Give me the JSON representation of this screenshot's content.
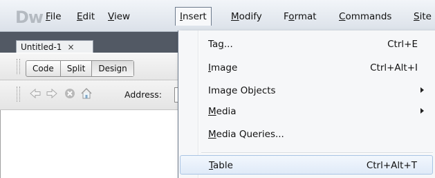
{
  "app": {
    "logo": "Dw"
  },
  "menubar": {
    "items": [
      {
        "pre": "",
        "u": "F",
        "post": "ile"
      },
      {
        "pre": "",
        "u": "E",
        "post": "dit"
      },
      {
        "pre": "",
        "u": "V",
        "post": "iew"
      },
      {
        "pre": "",
        "u": "I",
        "post": "nsert"
      },
      {
        "pre": "",
        "u": "M",
        "post": "odify"
      },
      {
        "pre": "F",
        "u": "o",
        "post": "rmat"
      },
      {
        "pre": "",
        "u": "C",
        "post": "ommands"
      },
      {
        "pre": "",
        "u": "S",
        "post": "ite"
      }
    ],
    "active": "Insert"
  },
  "document_tab": {
    "title": "Untitled-1",
    "close_glyph": "×"
  },
  "view_buttons": [
    {
      "label": "Code"
    },
    {
      "label": "Split"
    },
    {
      "label": "Design",
      "selected": true
    }
  ],
  "address_bar": {
    "label": "Address:",
    "value": ""
  },
  "insert_menu": {
    "items": [
      {
        "pre": "Ta",
        "u": "g",
        "post": "...",
        "shortcut": "Ctrl+E",
        "submenu": false
      },
      {
        "pre": "",
        "u": "I",
        "post": "mage",
        "shortcut": "Ctrl+Alt+I",
        "submenu": false
      },
      {
        "pre": "Image Objects",
        "u": "",
        "post": "",
        "shortcut": "",
        "submenu": true
      },
      {
        "pre": "",
        "u": "M",
        "post": "edia",
        "shortcut": "",
        "submenu": true
      },
      {
        "pre": "",
        "u": "M",
        "post": "edia Queries...",
        "shortcut": "",
        "submenu": false
      },
      {
        "pre": "",
        "u": "T",
        "post": "able",
        "shortcut": "Ctrl+Alt+T",
        "submenu": false,
        "highlighted": true
      }
    ]
  },
  "colors": {
    "tab_row_bg": "#525964",
    "highlight_border": "#a9c4e4"
  }
}
